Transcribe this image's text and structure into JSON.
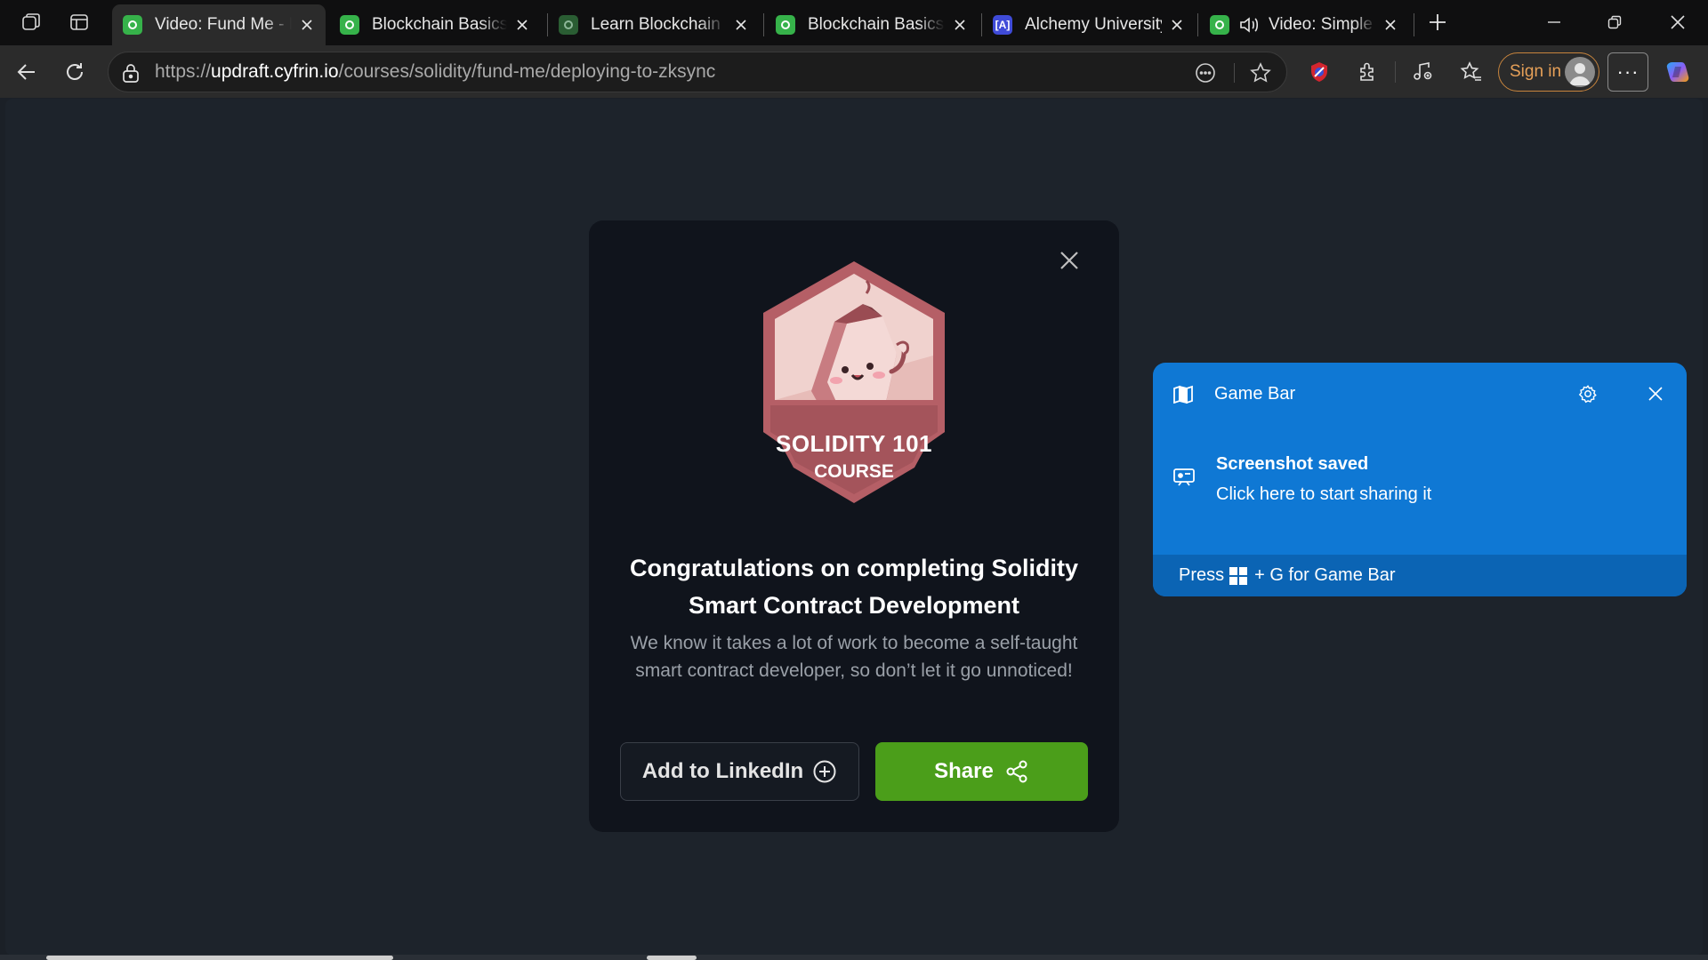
{
  "browser": {
    "tabs": [
      {
        "title": "Video: Fund Me - Deploying to zkSync",
        "favicon": "updraft-icon",
        "active": true
      },
      {
        "title": "Blockchain Basics - Cyfrin Updraft",
        "favicon": "updraft-icon",
        "active": false
      },
      {
        "title": "Learn Blockchain Basics",
        "favicon": "updraft-icon",
        "active": false
      },
      {
        "title": "Blockchain Basics - Cyfrin Updraft",
        "favicon": "updraft-icon",
        "active": false
      },
      {
        "title": "Alchemy University",
        "favicon": "alchemy-icon",
        "active": false
      },
      {
        "title": "Video: Simple Storage",
        "favicon": "updraft-icon",
        "active": false
      }
    ],
    "url_prefix": "https://",
    "url_host": "updraft.cyfrin.io",
    "url_path": "/courses/solidity/fund-me/deploying-to-zksync",
    "sign_in_label": "Sign in",
    "more_label": "···"
  },
  "modal": {
    "badge_line1": "SOLIDITY 101",
    "badge_line2": "COURSE",
    "title": "Congratulations on completing Solidity Smart Contract Development",
    "description": "We know it takes a lot of work to become a self-taught smart contract developer, so don’t let it go unnoticed!",
    "linkedin_label": "Add to LinkedIn",
    "share_label": "Share"
  },
  "game_bar": {
    "title": "Game Bar",
    "heading": "Screenshot saved",
    "subtext": "Click here to start sharing it",
    "footer_before": "Press",
    "footer_after": "+ G for Game Bar"
  },
  "colors": {
    "share_button": "#4b9e1a",
    "toast_background": "#0f78d4",
    "badge_frame": "#b55f66",
    "sign_in_border": "#c7843d"
  }
}
